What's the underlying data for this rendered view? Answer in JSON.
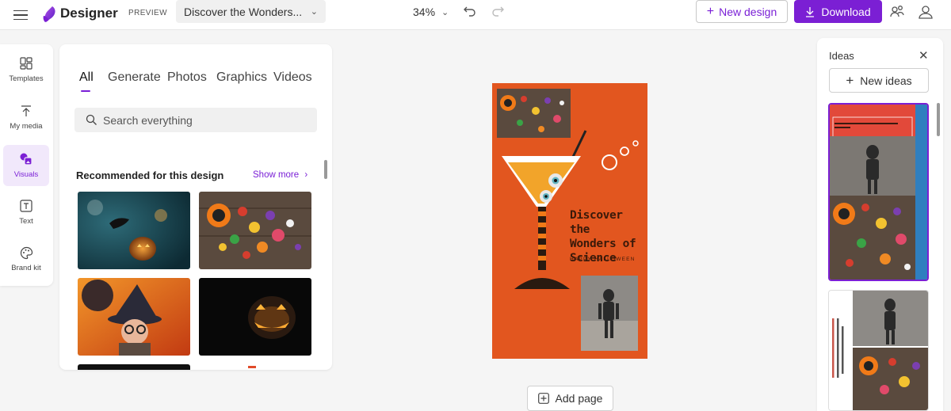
{
  "app": {
    "name": "Designer",
    "badge": "PREVIEW",
    "doc_title": "Discover the Wonders...",
    "zoom": "34%",
    "new_design": "New design",
    "download": "Download",
    "brand_color": "#7b1fd4"
  },
  "rail": [
    {
      "label": "Templates",
      "icon": "templates-icon"
    },
    {
      "label": "My media",
      "icon": "upload-icon"
    },
    {
      "label": "Visuals",
      "icon": "visuals-icon",
      "active": true
    },
    {
      "label": "Text",
      "icon": "text-icon"
    },
    {
      "label": "Brand kit",
      "icon": "palette-icon"
    }
  ],
  "panel": {
    "tabs": [
      "All",
      "Generate",
      "Photos",
      "Graphics",
      "Videos"
    ],
    "active_tab": "All",
    "search_placeholder": "Search everything",
    "section_title": "Recommended for this design",
    "show_more": "Show more"
  },
  "canvas": {
    "headline": "Discover the\nWonders of\nScience",
    "subline": "HAPPY HALLOWEEN",
    "background": "#e2561f",
    "add_page": "Add page"
  },
  "ideas": {
    "title": "Ideas",
    "new_ideas": "New ideas"
  }
}
